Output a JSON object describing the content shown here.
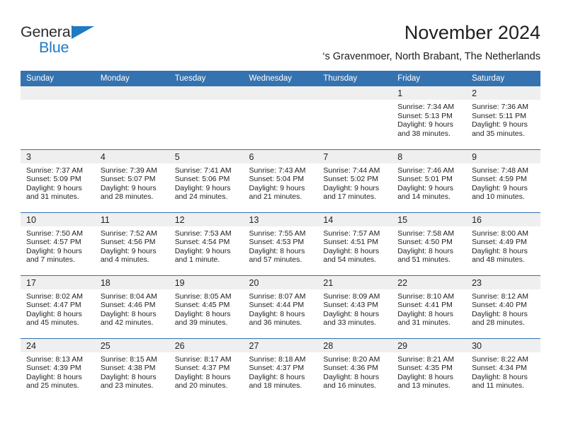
{
  "logo": {
    "word_top": "General",
    "word_bottom": "Blue",
    "triangle_color": "#1f7ac4",
    "text_color": "#2b2b2b"
  },
  "header": {
    "title": "November 2024",
    "location": "‘s Gravenmoer, North Brabant, The Netherlands"
  },
  "theme": {
    "header_blue": "#3572b0",
    "daynum_band": "#efefef",
    "text": "#222222",
    "page_bg": "#ffffff"
  },
  "weekday_headers": [
    "Sunday",
    "Monday",
    "Tuesday",
    "Wednesday",
    "Thursday",
    "Friday",
    "Saturday"
  ],
  "weeks": [
    [
      {
        "empty": true
      },
      {
        "empty": true
      },
      {
        "empty": true
      },
      {
        "empty": true
      },
      {
        "empty": true
      },
      {
        "day": "1",
        "sunrise": "Sunrise: 7:34 AM",
        "sunset": "Sunset: 5:13 PM",
        "daylight_1": "Daylight: 9 hours",
        "daylight_2": "and 38 minutes."
      },
      {
        "day": "2",
        "sunrise": "Sunrise: 7:36 AM",
        "sunset": "Sunset: 5:11 PM",
        "daylight_1": "Daylight: 9 hours",
        "daylight_2": "and 35 minutes."
      }
    ],
    [
      {
        "day": "3",
        "sunrise": "Sunrise: 7:37 AM",
        "sunset": "Sunset: 5:09 PM",
        "daylight_1": "Daylight: 9 hours",
        "daylight_2": "and 31 minutes."
      },
      {
        "day": "4",
        "sunrise": "Sunrise: 7:39 AM",
        "sunset": "Sunset: 5:07 PM",
        "daylight_1": "Daylight: 9 hours",
        "daylight_2": "and 28 minutes."
      },
      {
        "day": "5",
        "sunrise": "Sunrise: 7:41 AM",
        "sunset": "Sunset: 5:06 PM",
        "daylight_1": "Daylight: 9 hours",
        "daylight_2": "and 24 minutes."
      },
      {
        "day": "6",
        "sunrise": "Sunrise: 7:43 AM",
        "sunset": "Sunset: 5:04 PM",
        "daylight_1": "Daylight: 9 hours",
        "daylight_2": "and 21 minutes."
      },
      {
        "day": "7",
        "sunrise": "Sunrise: 7:44 AM",
        "sunset": "Sunset: 5:02 PM",
        "daylight_1": "Daylight: 9 hours",
        "daylight_2": "and 17 minutes."
      },
      {
        "day": "8",
        "sunrise": "Sunrise: 7:46 AM",
        "sunset": "Sunset: 5:01 PM",
        "daylight_1": "Daylight: 9 hours",
        "daylight_2": "and 14 minutes."
      },
      {
        "day": "9",
        "sunrise": "Sunrise: 7:48 AM",
        "sunset": "Sunset: 4:59 PM",
        "daylight_1": "Daylight: 9 hours",
        "daylight_2": "and 10 minutes."
      }
    ],
    [
      {
        "day": "10",
        "sunrise": "Sunrise: 7:50 AM",
        "sunset": "Sunset: 4:57 PM",
        "daylight_1": "Daylight: 9 hours",
        "daylight_2": "and 7 minutes."
      },
      {
        "day": "11",
        "sunrise": "Sunrise: 7:52 AM",
        "sunset": "Sunset: 4:56 PM",
        "daylight_1": "Daylight: 9 hours",
        "daylight_2": "and 4 minutes."
      },
      {
        "day": "12",
        "sunrise": "Sunrise: 7:53 AM",
        "sunset": "Sunset: 4:54 PM",
        "daylight_1": "Daylight: 9 hours",
        "daylight_2": "and 1 minute."
      },
      {
        "day": "13",
        "sunrise": "Sunrise: 7:55 AM",
        "sunset": "Sunset: 4:53 PM",
        "daylight_1": "Daylight: 8 hours",
        "daylight_2": "and 57 minutes."
      },
      {
        "day": "14",
        "sunrise": "Sunrise: 7:57 AM",
        "sunset": "Sunset: 4:51 PM",
        "daylight_1": "Daylight: 8 hours",
        "daylight_2": "and 54 minutes."
      },
      {
        "day": "15",
        "sunrise": "Sunrise: 7:58 AM",
        "sunset": "Sunset: 4:50 PM",
        "daylight_1": "Daylight: 8 hours",
        "daylight_2": "and 51 minutes."
      },
      {
        "day": "16",
        "sunrise": "Sunrise: 8:00 AM",
        "sunset": "Sunset: 4:49 PM",
        "daylight_1": "Daylight: 8 hours",
        "daylight_2": "and 48 minutes."
      }
    ],
    [
      {
        "day": "17",
        "sunrise": "Sunrise: 8:02 AM",
        "sunset": "Sunset: 4:47 PM",
        "daylight_1": "Daylight: 8 hours",
        "daylight_2": "and 45 minutes."
      },
      {
        "day": "18",
        "sunrise": "Sunrise: 8:04 AM",
        "sunset": "Sunset: 4:46 PM",
        "daylight_1": "Daylight: 8 hours",
        "daylight_2": "and 42 minutes."
      },
      {
        "day": "19",
        "sunrise": "Sunrise: 8:05 AM",
        "sunset": "Sunset: 4:45 PM",
        "daylight_1": "Daylight: 8 hours",
        "daylight_2": "and 39 minutes."
      },
      {
        "day": "20",
        "sunrise": "Sunrise: 8:07 AM",
        "sunset": "Sunset: 4:44 PM",
        "daylight_1": "Daylight: 8 hours",
        "daylight_2": "and 36 minutes."
      },
      {
        "day": "21",
        "sunrise": "Sunrise: 8:09 AM",
        "sunset": "Sunset: 4:43 PM",
        "daylight_1": "Daylight: 8 hours",
        "daylight_2": "and 33 minutes."
      },
      {
        "day": "22",
        "sunrise": "Sunrise: 8:10 AM",
        "sunset": "Sunset: 4:41 PM",
        "daylight_1": "Daylight: 8 hours",
        "daylight_2": "and 31 minutes."
      },
      {
        "day": "23",
        "sunrise": "Sunrise: 8:12 AM",
        "sunset": "Sunset: 4:40 PM",
        "daylight_1": "Daylight: 8 hours",
        "daylight_2": "and 28 minutes."
      }
    ],
    [
      {
        "day": "24",
        "sunrise": "Sunrise: 8:13 AM",
        "sunset": "Sunset: 4:39 PM",
        "daylight_1": "Daylight: 8 hours",
        "daylight_2": "and 25 minutes."
      },
      {
        "day": "25",
        "sunrise": "Sunrise: 8:15 AM",
        "sunset": "Sunset: 4:38 PM",
        "daylight_1": "Daylight: 8 hours",
        "daylight_2": "and 23 minutes."
      },
      {
        "day": "26",
        "sunrise": "Sunrise: 8:17 AM",
        "sunset": "Sunset: 4:37 PM",
        "daylight_1": "Daylight: 8 hours",
        "daylight_2": "and 20 minutes."
      },
      {
        "day": "27",
        "sunrise": "Sunrise: 8:18 AM",
        "sunset": "Sunset: 4:37 PM",
        "daylight_1": "Daylight: 8 hours",
        "daylight_2": "and 18 minutes."
      },
      {
        "day": "28",
        "sunrise": "Sunrise: 8:20 AM",
        "sunset": "Sunset: 4:36 PM",
        "daylight_1": "Daylight: 8 hours",
        "daylight_2": "and 16 minutes."
      },
      {
        "day": "29",
        "sunrise": "Sunrise: 8:21 AM",
        "sunset": "Sunset: 4:35 PM",
        "daylight_1": "Daylight: 8 hours",
        "daylight_2": "and 13 minutes."
      },
      {
        "day": "30",
        "sunrise": "Sunrise: 8:22 AM",
        "sunset": "Sunset: 4:34 PM",
        "daylight_1": "Daylight: 8 hours",
        "daylight_2": "and 11 minutes."
      }
    ]
  ]
}
